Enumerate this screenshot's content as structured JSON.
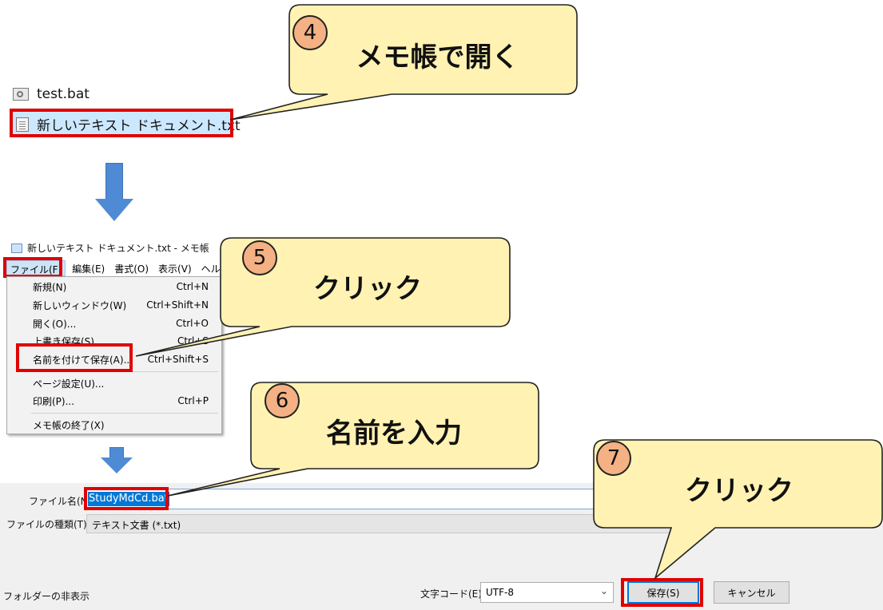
{
  "explorer": {
    "files": [
      {
        "name": "test.bat",
        "icon": "bat-file-icon"
      },
      {
        "name": "新しいテキスト ドキュメント.txt",
        "icon": "text-file-icon"
      }
    ]
  },
  "notepad": {
    "title": "新しいテキスト ドキュメント.txt - メモ帳",
    "menus": [
      "ファイル(F)",
      "編集(E)",
      "書式(O)",
      "表示(V)",
      "ヘルプ(H)"
    ],
    "file_menu": [
      {
        "label": "新規(N)",
        "shortcut": "Ctrl+N"
      },
      {
        "label": "新しいウィンドウ(W)",
        "shortcut": "Ctrl+Shift+N"
      },
      {
        "label": "開く(O)...",
        "shortcut": "Ctrl+O"
      },
      {
        "label": "上書き保存(S)",
        "shortcut": "Ctrl+S"
      },
      {
        "label": "名前を付けて保存(A)...",
        "shortcut": "Ctrl+Shift+S"
      },
      {
        "label": "ページ設定(U)...",
        "shortcut": ""
      },
      {
        "label": "印刷(P)...",
        "shortcut": "Ctrl+P"
      },
      {
        "label": "メモ帳の終了(X)",
        "shortcut": ""
      }
    ]
  },
  "callouts": [
    {
      "step": "4",
      "text": "メモ帳で開く"
    },
    {
      "step": "5",
      "text": "クリック"
    },
    {
      "step": "6",
      "text": "名前を入力"
    },
    {
      "step": "7",
      "text": "クリック"
    }
  ],
  "save_dialog": {
    "filename_label": "ファイル名(N):",
    "filename_value": "StudyMdCd.bat",
    "filetype_label": "ファイルの種類(T):",
    "filetype_value": "テキスト文書 (*.txt)",
    "hide_folders": "フォルダーの非表示",
    "encoding_label": "文字コード(E):",
    "encoding_value": "UTF-8",
    "save_button": "保存(S)",
    "cancel_button": "キャンセル"
  },
  "colors": {
    "highlight_red": "#e00000",
    "callout_fill": "#fff2b3",
    "badge_fill": "#f4b183",
    "arrow_blue": "#4f8bd4",
    "selection_blue": "#0078d7"
  }
}
